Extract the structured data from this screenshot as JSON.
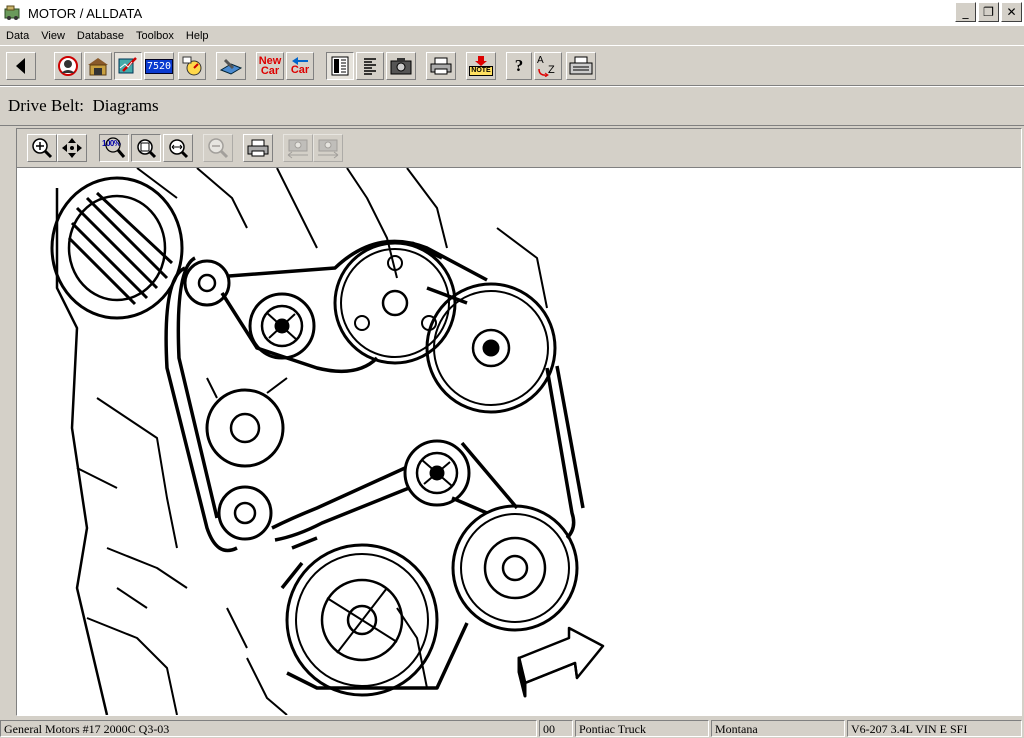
{
  "window": {
    "title": "MOTOR / ALLDATA",
    "minimize": "_",
    "restore": "❐",
    "close": "✕"
  },
  "menu": [
    "Data",
    "View",
    "Database",
    "Toolbox",
    "Help"
  ],
  "toolbar": {
    "new_car_1": "New",
    "new_car_2": "Car",
    "chip_7520": "7520",
    "note_label": "NOTE",
    "help_glyph": "?",
    "az_a": "A",
    "az_z": "Z"
  },
  "breadcrumb": "Drive Belt:  Diagrams",
  "viewer_toolbar": {
    "zoom_100_label": "100%"
  },
  "status": {
    "manufacturer": "General Motors #17  2000C Q3-03",
    "code": "00",
    "make": "Pontiac Truck",
    "model": "Montana",
    "engine": "V6-207 3.4L VIN E SFI"
  }
}
